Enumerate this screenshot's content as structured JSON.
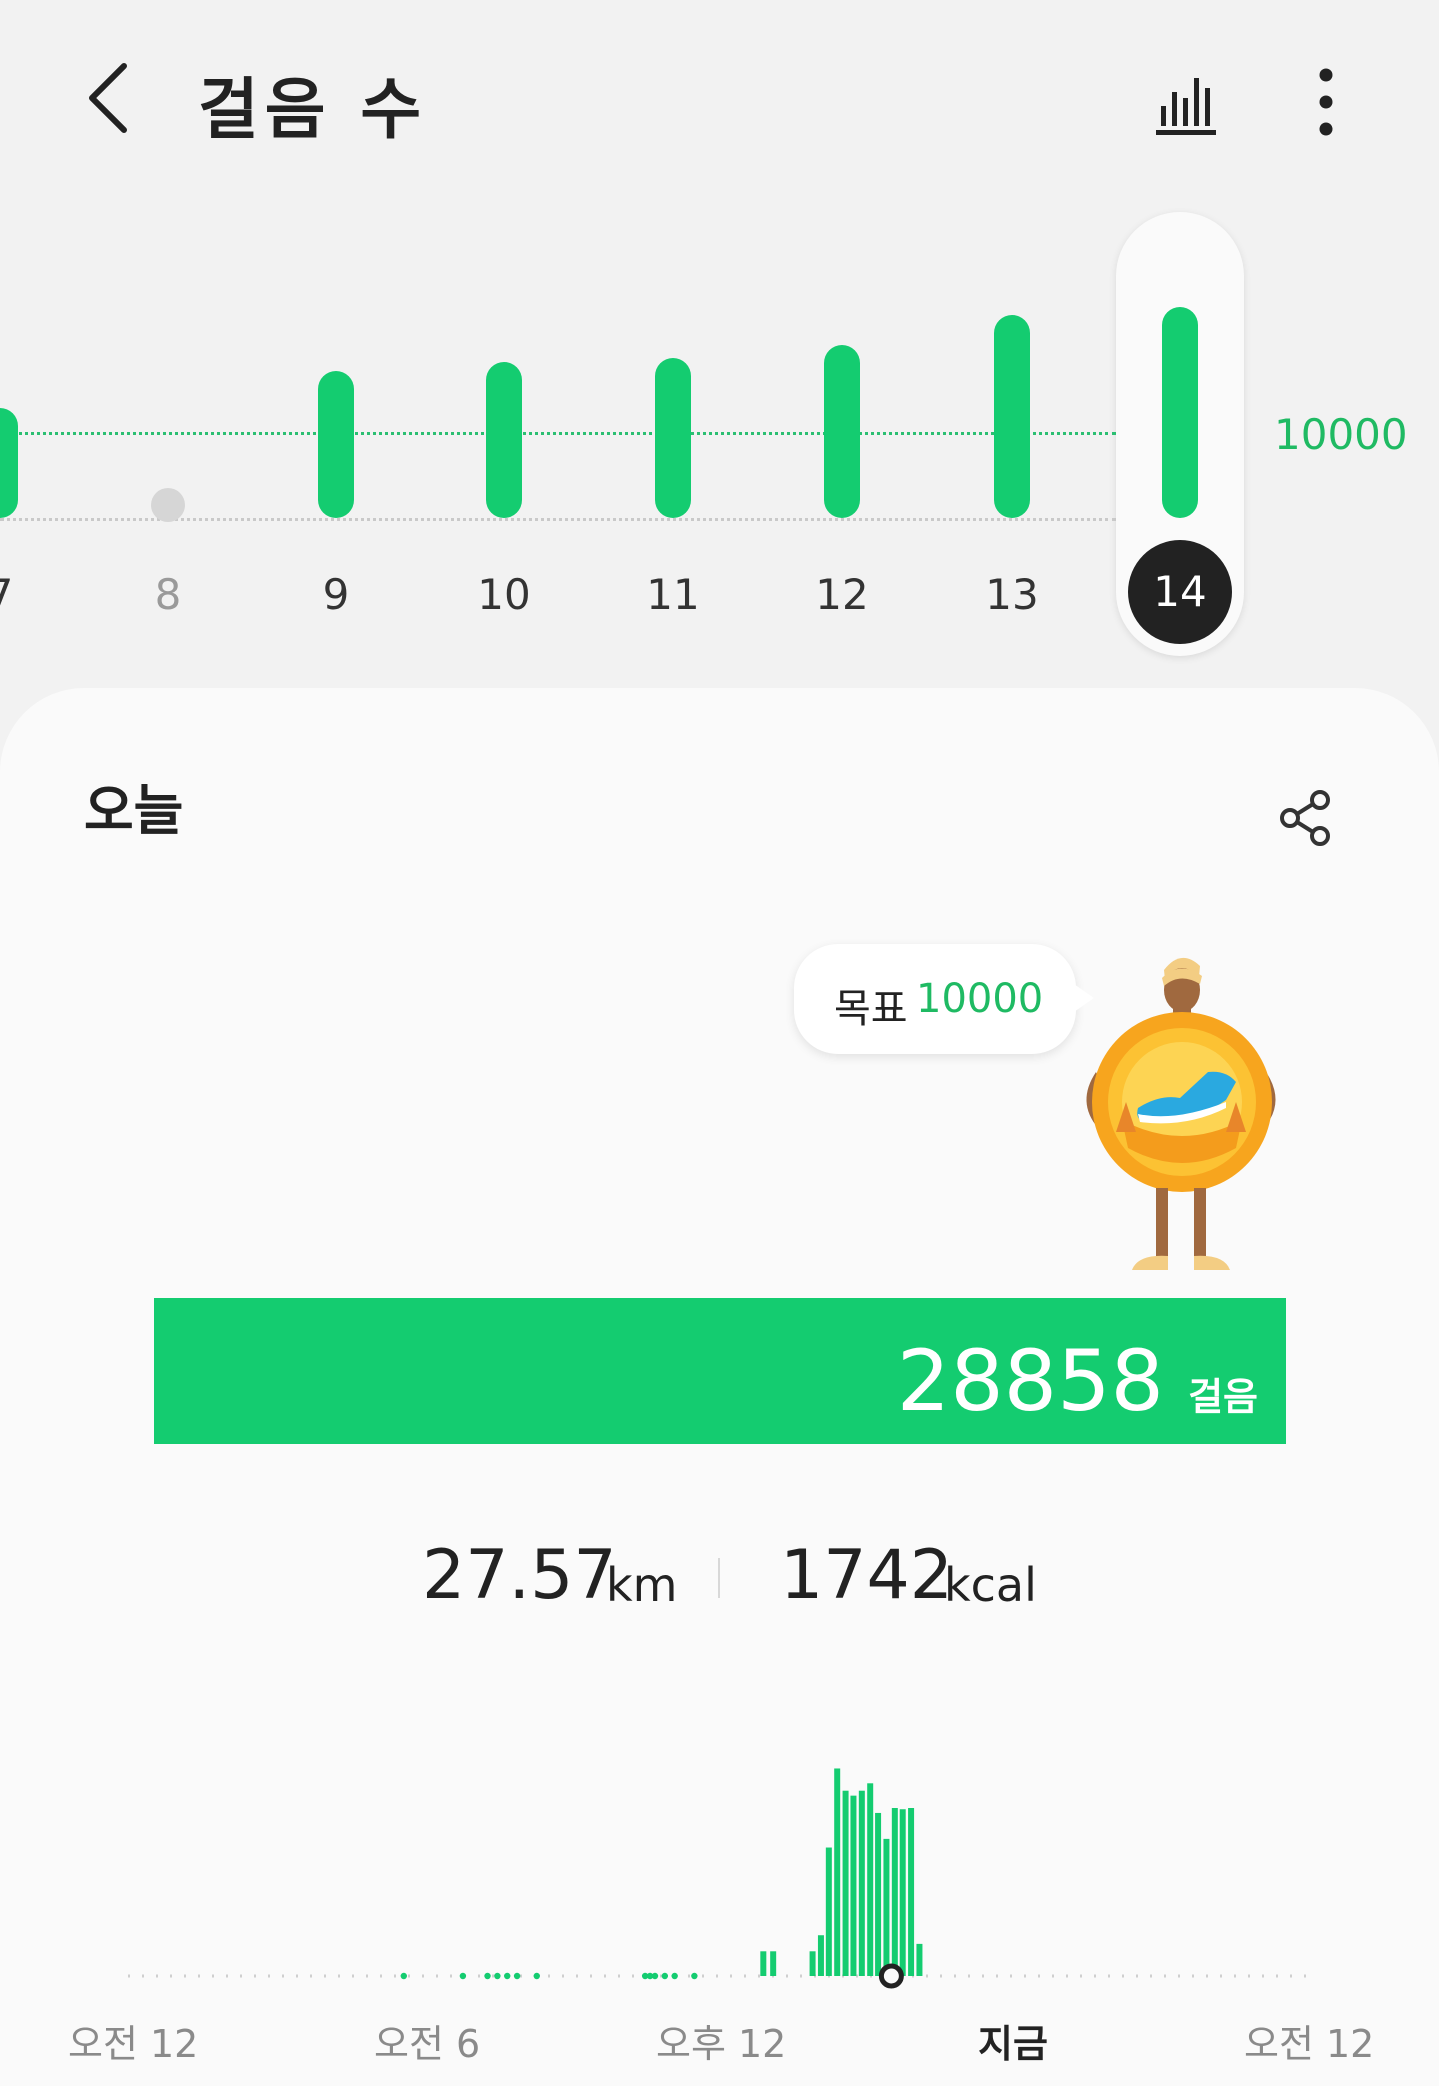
{
  "header": {
    "title": "걸음 수",
    "back_icon": "chevron-left-icon",
    "chart_icon": "bar-chart-icon",
    "more_icon": "more-vertical-icon"
  },
  "daily_chart": {
    "goal_label": "10000",
    "selected_day": "14",
    "goal_value": 10000,
    "days": [
      {
        "label": "7",
        "value": 10700
      },
      {
        "label": "8",
        "value": 0
      },
      {
        "label": "9",
        "value": 15000
      },
      {
        "label": "10",
        "value": 16000
      },
      {
        "label": "11",
        "value": 16500
      },
      {
        "label": "12",
        "value": 18000
      },
      {
        "label": "13",
        "value": 21500
      },
      {
        "label": "14",
        "value": 22500
      }
    ]
  },
  "today": {
    "title": "오늘",
    "share_icon": "share-icon",
    "goal_bubble": {
      "label": "목표",
      "value": "10000"
    },
    "steps": {
      "value": "28858",
      "unit": "걸음",
      "progress_percent": 100
    },
    "distance": {
      "value": "27.57",
      "unit": "km"
    },
    "calories": {
      "value": "1742",
      "unit": "kcal"
    }
  },
  "hourly_chart": {
    "x_labels": {
      "start": "오전 12",
      "morning": "오전 6",
      "noon": "오후 12",
      "now": "지금",
      "end": "오전 12"
    },
    "now_hour": 15.5,
    "bars": [
      {
        "hour": 12.9,
        "value": 200
      },
      {
        "hour": 13.1,
        "value": 200
      },
      {
        "hour": 13.9,
        "value": 200
      },
      {
        "hour": 14.07,
        "value": 330
      },
      {
        "hour": 14.23,
        "value": 1040
      },
      {
        "hour": 14.4,
        "value": 1680
      },
      {
        "hour": 14.57,
        "value": 1500
      },
      {
        "hour": 14.73,
        "value": 1460
      },
      {
        "hour": 14.9,
        "value": 1500
      },
      {
        "hour": 15.07,
        "value": 1560
      },
      {
        "hour": 15.23,
        "value": 1320
      },
      {
        "hour": 15.4,
        "value": 1110
      },
      {
        "hour": 15.57,
        "value": 1360
      },
      {
        "hour": 15.73,
        "value": 1350
      },
      {
        "hour": 15.9,
        "value": 1360
      },
      {
        "hour": 16.07,
        "value": 260
      }
    ],
    "small_dots": [
      5.6,
      6.8,
      7.3,
      7.5,
      7.7,
      7.9,
      8.3,
      10.5,
      10.6,
      10.7,
      10.9,
      11.1,
      11.5
    ]
  },
  "colors": {
    "accent": "#14cc70",
    "goal_text": "#1fba63",
    "background": "#f2f2f2",
    "card": "#fafafa",
    "selected": "#222222"
  }
}
